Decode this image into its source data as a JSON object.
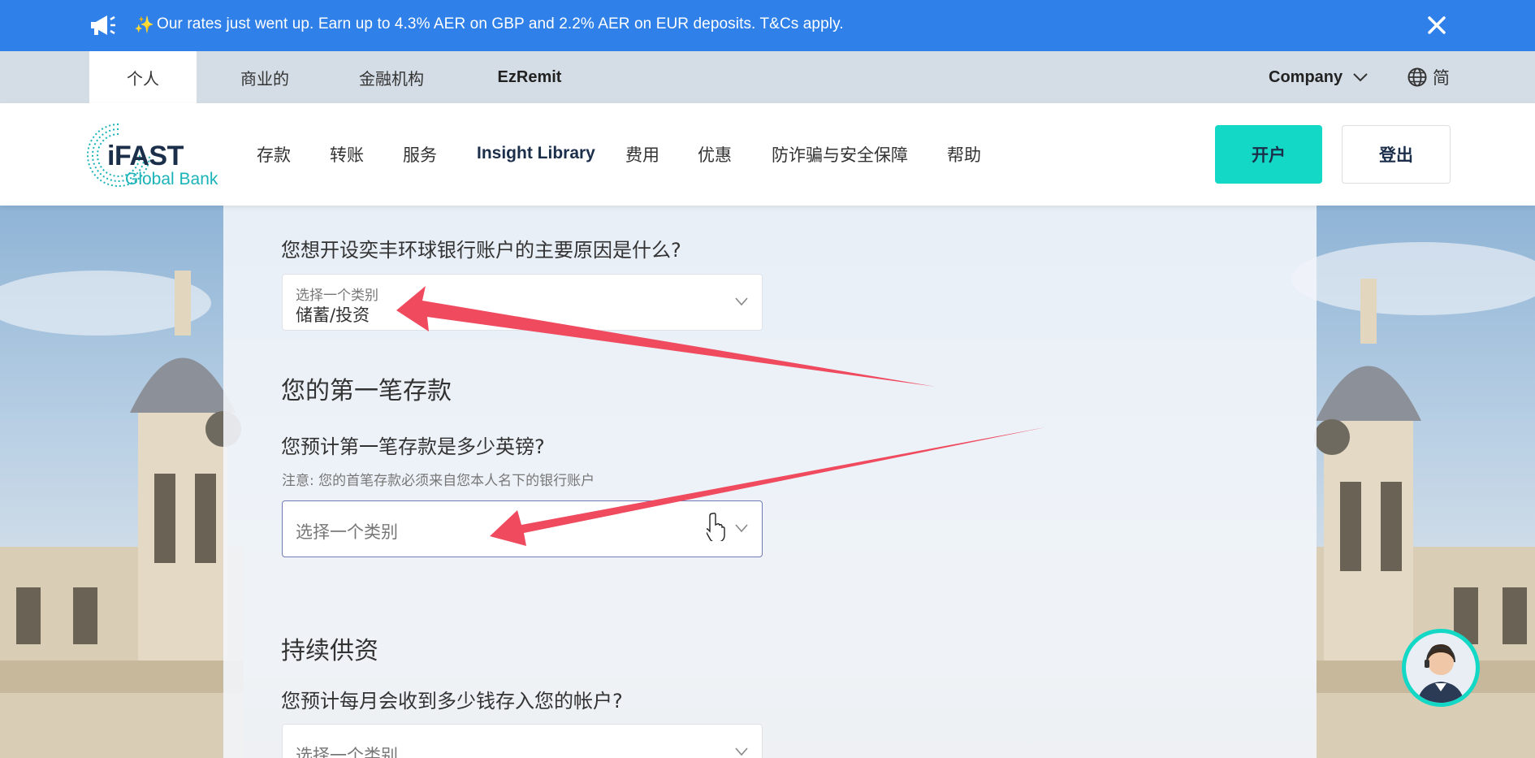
{
  "announcement": {
    "message": "Our rates just went up. Earn up to 4.3% AER on GBP and 2.2% AER on EUR deposits. T&Cs apply."
  },
  "segments": {
    "tabs": [
      {
        "label": "个人"
      },
      {
        "label": "商业的"
      },
      {
        "label": "金融机构"
      },
      {
        "label": "EzRemit"
      }
    ],
    "company_label": "Company",
    "language_label": "简"
  },
  "header": {
    "logo_main": "iFAST",
    "logo_sub": "Global Bank",
    "nav": [
      {
        "label": "存款"
      },
      {
        "label": "转账"
      },
      {
        "label": "服务"
      },
      {
        "label": "Insight Library"
      },
      {
        "label": "费用"
      },
      {
        "label": "优惠"
      },
      {
        "label": "防诈骗与安全保障"
      },
      {
        "label": "帮助"
      }
    ],
    "open_button": "开户",
    "logout_button": "登出"
  },
  "form": {
    "q1": {
      "question": "您想开设奕丰环球银行账户的主要原因是什么?",
      "select_label": "选择一个类别",
      "select_value": "储蓄/投资"
    },
    "section_first_deposit": "您的第一笔存款",
    "q2": {
      "question": "您预计第一笔存款是多少英镑?",
      "note": "注意: 您的首笔存款必须来自您本人名下的银行账户",
      "placeholder": "选择一个类别"
    },
    "section_funding": "持续供资",
    "q3": {
      "question": "您预计每月会收到多少钱存入您的帐户?",
      "placeholder": "选择一个类别"
    }
  },
  "colors": {
    "announcement_bg": "#2f80e8",
    "accent_teal": "#13d8c5",
    "annotation_arrow": "#f04a5f"
  }
}
